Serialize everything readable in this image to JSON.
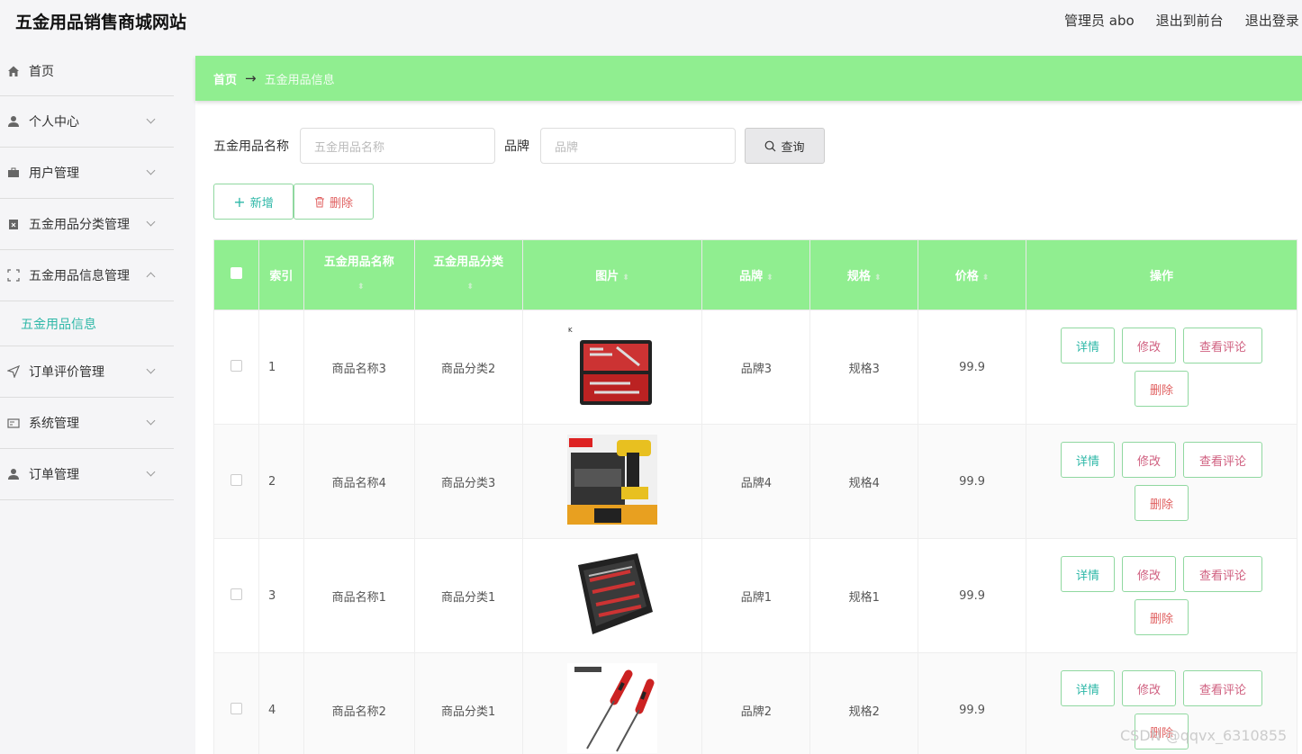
{
  "header": {
    "title": "五金用品销售商城网站",
    "admin": "管理员 abo",
    "to_front": "退出到前台",
    "logout": "退出登录"
  },
  "sidebar": {
    "items": [
      {
        "label": "首页",
        "icon": "home-icon"
      },
      {
        "label": "个人中心",
        "icon": "user-icon"
      },
      {
        "label": "用户管理",
        "icon": "briefcase-icon"
      },
      {
        "label": "五金用品分类管理",
        "icon": "clipboard-icon"
      },
      {
        "label": "五金用品信息管理",
        "icon": "frame-icon"
      },
      {
        "label": "订单评价管理",
        "icon": "send-icon"
      },
      {
        "label": "系统管理",
        "icon": "card-icon"
      },
      {
        "label": "订单管理",
        "icon": "user-icon"
      }
    ],
    "submenu_label": "五金用品信息"
  },
  "breadcrumb": {
    "home": "首页",
    "arrow": "→",
    "current": "五金用品信息"
  },
  "search": {
    "name_label": "五金用品名称",
    "name_placeholder": "五金用品名称",
    "brand_label": "品牌",
    "brand_placeholder": "品牌",
    "query_label": "查询"
  },
  "actions": {
    "add_label": "新增",
    "delete_label": "删除"
  },
  "table": {
    "headers": [
      "索引",
      "五金用品名称",
      "五金用品分类",
      "图片",
      "品牌",
      "规格",
      "价格",
      "操作"
    ],
    "rows": [
      {
        "index": "1",
        "name": "商品名称3",
        "category": "商品分类2",
        "brand": "品牌3",
        "spec": "规格3",
        "price": "99.9"
      },
      {
        "index": "2",
        "name": "商品名称4",
        "category": "商品分类3",
        "brand": "品牌4",
        "spec": "规格4",
        "price": "99.9"
      },
      {
        "index": "3",
        "name": "商品名称1",
        "category": "商品分类1",
        "brand": "品牌1",
        "spec": "规格1",
        "price": "99.9"
      },
      {
        "index": "4",
        "name": "商品名称2",
        "category": "商品分类1",
        "brand": "品牌2",
        "spec": "规格2",
        "price": "99.9"
      }
    ],
    "row_ops": {
      "detail": "详情",
      "edit": "修改",
      "review": "查看评论",
      "remove": "删除"
    }
  },
  "watermark": "CSDN @qqvx_6310855",
  "colors": {
    "accent_green": "#90ee90",
    "teal": "#2fb8a8",
    "red": "#e06060"
  }
}
